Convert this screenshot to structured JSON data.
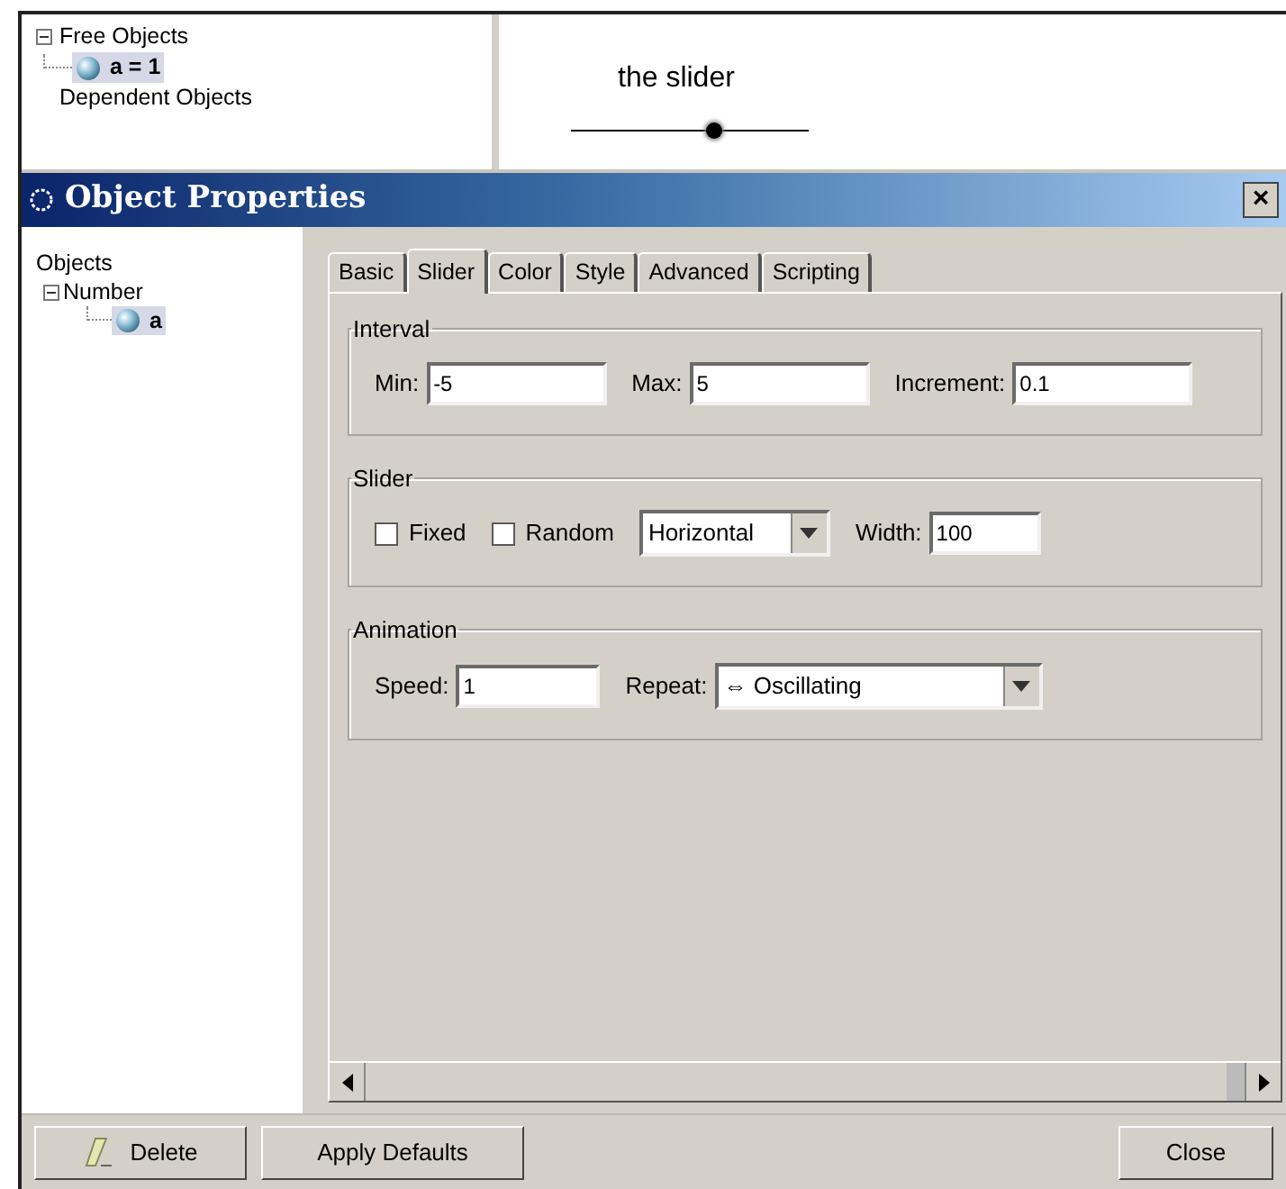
{
  "algebra_view": {
    "groups": [
      {
        "label": "Free Objects",
        "expanded": true,
        "items": [
          {
            "label": "a = 1",
            "selected": true
          }
        ]
      },
      {
        "label": "Dependent Objects"
      }
    ]
  },
  "graphics_view": {
    "slider": {
      "caption": "the slider",
      "level": 0.6
    }
  },
  "dialog": {
    "title": "Object Properties",
    "close_label": "×",
    "objects_tree": {
      "root": "Objects",
      "children": [
        {
          "label": "Number",
          "expanded": true,
          "children": [
            {
              "label": "a",
              "selected": true
            }
          ]
        }
      ]
    },
    "tabs": [
      {
        "label": "Basic",
        "selected": false
      },
      {
        "label": "Slider",
        "selected": true
      },
      {
        "label": "Color",
        "selected": false
      },
      {
        "label": "Style",
        "selected": false
      },
      {
        "label": "Advanced",
        "selected": false
      },
      {
        "label": "Scripting",
        "selected": false
      }
    ],
    "groups": [
      {
        "title": "Interval",
        "fields": [
          {
            "kind": "text",
            "label": "Min:",
            "value": "-5"
          },
          {
            "kind": "text",
            "label": "Max:",
            "value": "5"
          },
          {
            "kind": "text",
            "label": "Increment:",
            "value": "0.1"
          }
        ]
      },
      {
        "title": "Slider",
        "fields": [
          {
            "kind": "checkbox",
            "label": "Fixed",
            "checked": false
          },
          {
            "kind": "checkbox",
            "label": "Random",
            "checked": false
          },
          {
            "kind": "select",
            "value": "Horizontal"
          },
          {
            "kind": "text",
            "label": "Width:",
            "value": "100"
          }
        ]
      },
      {
        "title": "Animation",
        "fields": [
          {
            "kind": "text",
            "label": "Speed:",
            "value": "1"
          },
          {
            "kind": "select",
            "label": "Repeat:",
            "value": "⇔ Oscillating"
          }
        ]
      }
    ],
    "buttons": {
      "delete": "Delete",
      "apply_defaults": "Apply Defaults",
      "close": "Close"
    }
  }
}
